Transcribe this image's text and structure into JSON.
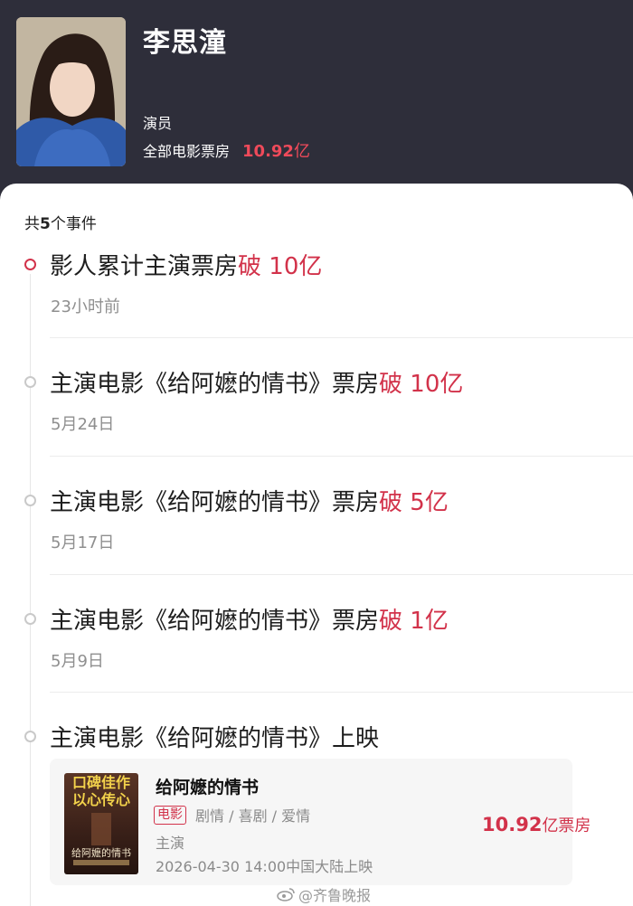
{
  "profile": {
    "name": "李思潼",
    "role": "演员",
    "box_label": "全部电影票房",
    "box_amount": "10.92",
    "box_unit": "亿"
  },
  "events_count": {
    "prefix": "共",
    "number": "5",
    "suffix": "个事件"
  },
  "events": [
    {
      "title": "影人累计主演票房",
      "highlight": "破 10亿",
      "date": "23小时前"
    },
    {
      "title": "主演电影《给阿嬷的情书》票房",
      "highlight": "破 10亿",
      "date": "5月24日"
    },
    {
      "title": "主演电影《给阿嬷的情书》票房",
      "highlight": "破 5亿",
      "date": "5月17日"
    },
    {
      "title": "主演电影《给阿嬷的情书》票房",
      "highlight": "破 1亿",
      "date": "5月9日"
    },
    {
      "title": "主演电影《给阿嬷的情书》上映",
      "highlight": "",
      "date": ""
    }
  ],
  "movie": {
    "title": "给阿嬷的情书",
    "tag": "电影",
    "genres": "剧情 / 喜剧 / 爱情",
    "role": "主演",
    "release": "2026-04-30 14:00中国大陆上映",
    "box_amount": "10.92",
    "box_unit": "亿票房",
    "poster_slogan": "口碑佳作以心传心",
    "poster_title": "给阿嬷的情书"
  },
  "watermark": "@齐鲁晚报",
  "colors": {
    "accent": "#d2324a",
    "header_bg": "#2e2e3a",
    "box_red": "#ef4a5a"
  }
}
